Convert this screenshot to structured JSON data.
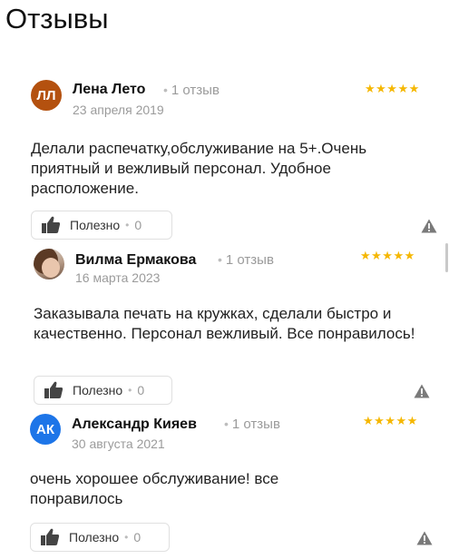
{
  "page": {
    "title": "Отзывы"
  },
  "reviews": [
    {
      "initials": "ЛЛ",
      "name": "Лена Лето",
      "reviews_count": "1 отзыв",
      "date": "23 апреля 2019",
      "rating": 5,
      "stars": "★★★★★",
      "text": "Делали распечатку,обслуживание на 5+.Очень приятный и вежливый персонал. Удобное расположение.",
      "useful_label": "Полезно",
      "useful_count": "0"
    },
    {
      "initials": "",
      "name": "Вилма Ермакова",
      "reviews_count": "1 отзыв",
      "date": "16 марта 2023",
      "rating": 5,
      "stars": "★★★★★",
      "text": "Заказывала печать на кружках, сделали быстро и качественно. Персонал вежливый. Все понравилось!",
      "useful_label": "Полезно",
      "useful_count": "0"
    },
    {
      "initials": "АК",
      "name": "Александр Кияев",
      "reviews_count": "1 отзыв",
      "date": "30 августа 2021",
      "rating": 5,
      "stars": "★★★★★",
      "text": "очень хорошее обслуживание! все понравилось",
      "useful_label": "Полезно",
      "useful_count": "0"
    }
  ],
  "colors": {
    "star": "#f5b700",
    "muted": "#9b9b9b",
    "avatar_1": "#b4510f",
    "avatar_3": "#1d75e8"
  },
  "icons": {
    "like": "thumbs-up-icon",
    "report": "warning-triangle-icon"
  }
}
